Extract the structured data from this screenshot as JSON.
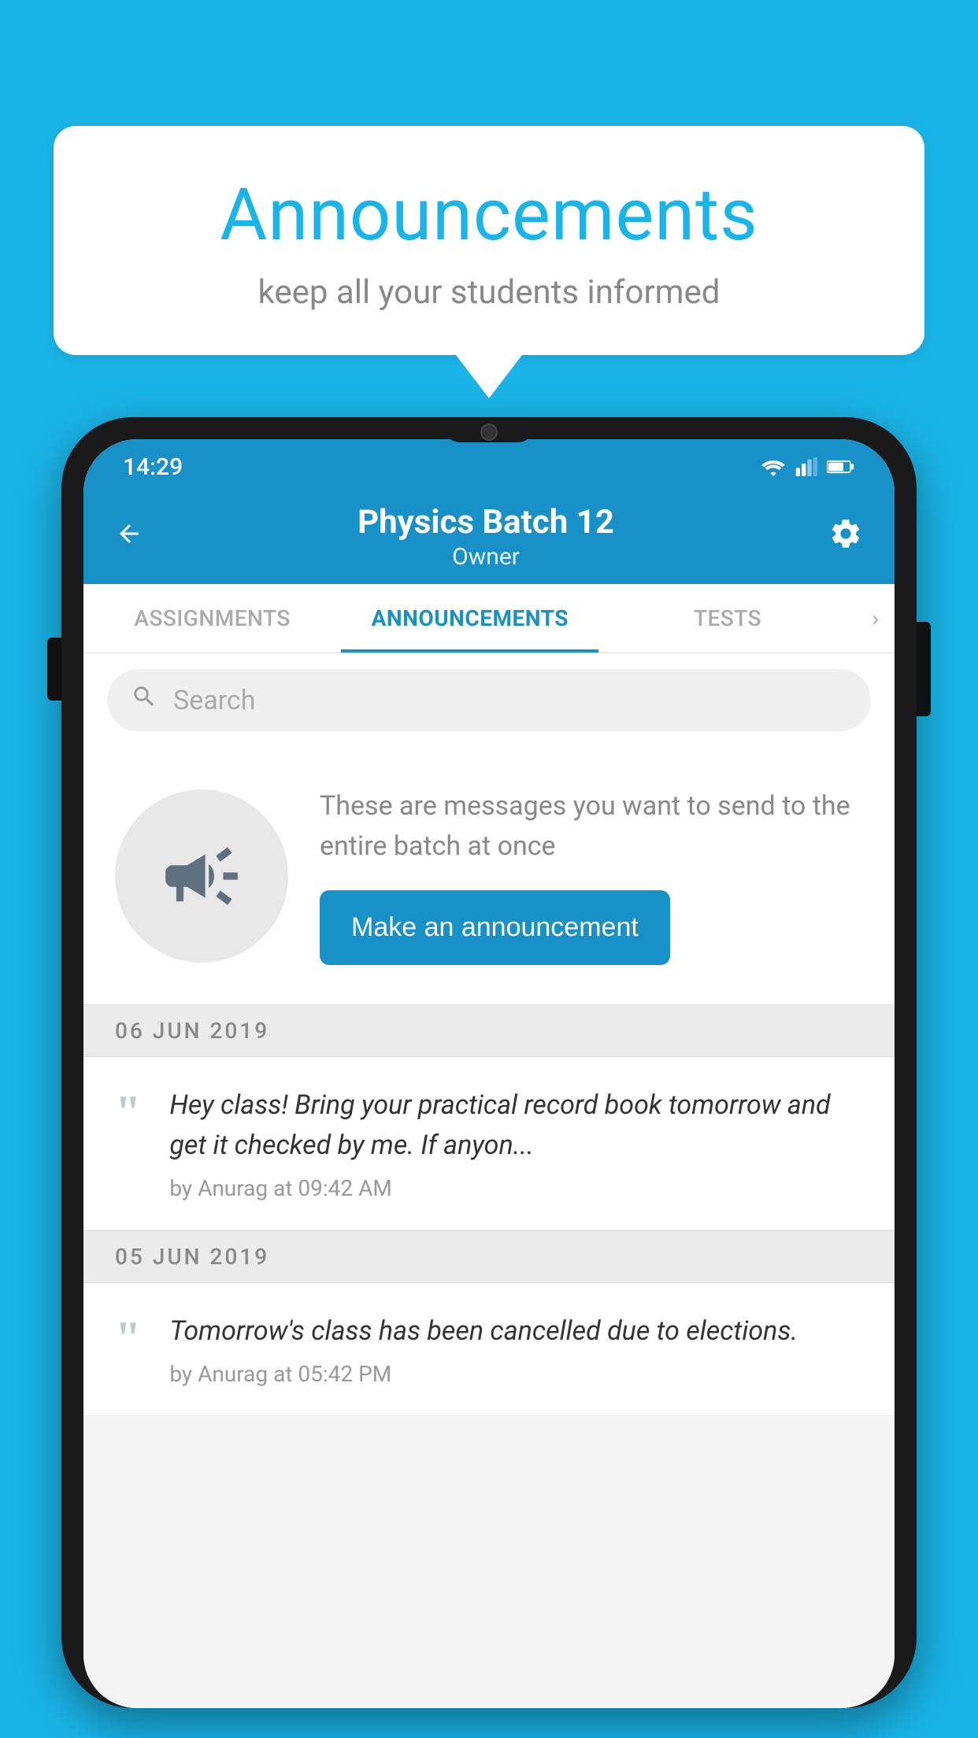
{
  "background": {
    "color": "#1ab5e8"
  },
  "speech_bubble": {
    "title": "Announcements",
    "subtitle": "keep all your students informed"
  },
  "phone": {
    "status_bar": {
      "time": "14:29"
    },
    "app_bar": {
      "back_icon": "←",
      "title": "Physics Batch 12",
      "subtitle": "Owner",
      "settings_icon": "⚙"
    },
    "tabs": [
      {
        "label": "ASSIGNMENTS",
        "active": false
      },
      {
        "label": "ANNOUNCEMENTS",
        "active": true
      },
      {
        "label": "TESTS",
        "active": false
      }
    ],
    "search": {
      "placeholder": "Search"
    },
    "announcement_prompt": {
      "description": "These are messages you want to send to the entire batch at once",
      "button_label": "Make an announcement"
    },
    "announcements": [
      {
        "date": "06  JUN  2019",
        "text": "Hey class! Bring your practical record book tomorrow and get it checked by me. If anyon...",
        "meta": "by Anurag at 09:42 AM"
      },
      {
        "date": "05  JUN  2019",
        "text": "Tomorrow's class has been cancelled due to elections.",
        "meta": "by Anurag at 05:42 PM"
      }
    ]
  }
}
